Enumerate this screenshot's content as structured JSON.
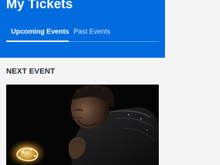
{
  "header": {
    "title": "My Tickets"
  },
  "tabs": [
    {
      "label": "Upcoming Events",
      "active": true
    },
    {
      "label": "Past Events",
      "active": false
    }
  ],
  "section": {
    "label": "NEXT EVENT"
  },
  "event_card": {
    "image": "event-photo-performer"
  },
  "colors": {
    "brand_blue": "#026cdf",
    "background": "#f4f4f4",
    "text_dark": "#1f262d"
  }
}
